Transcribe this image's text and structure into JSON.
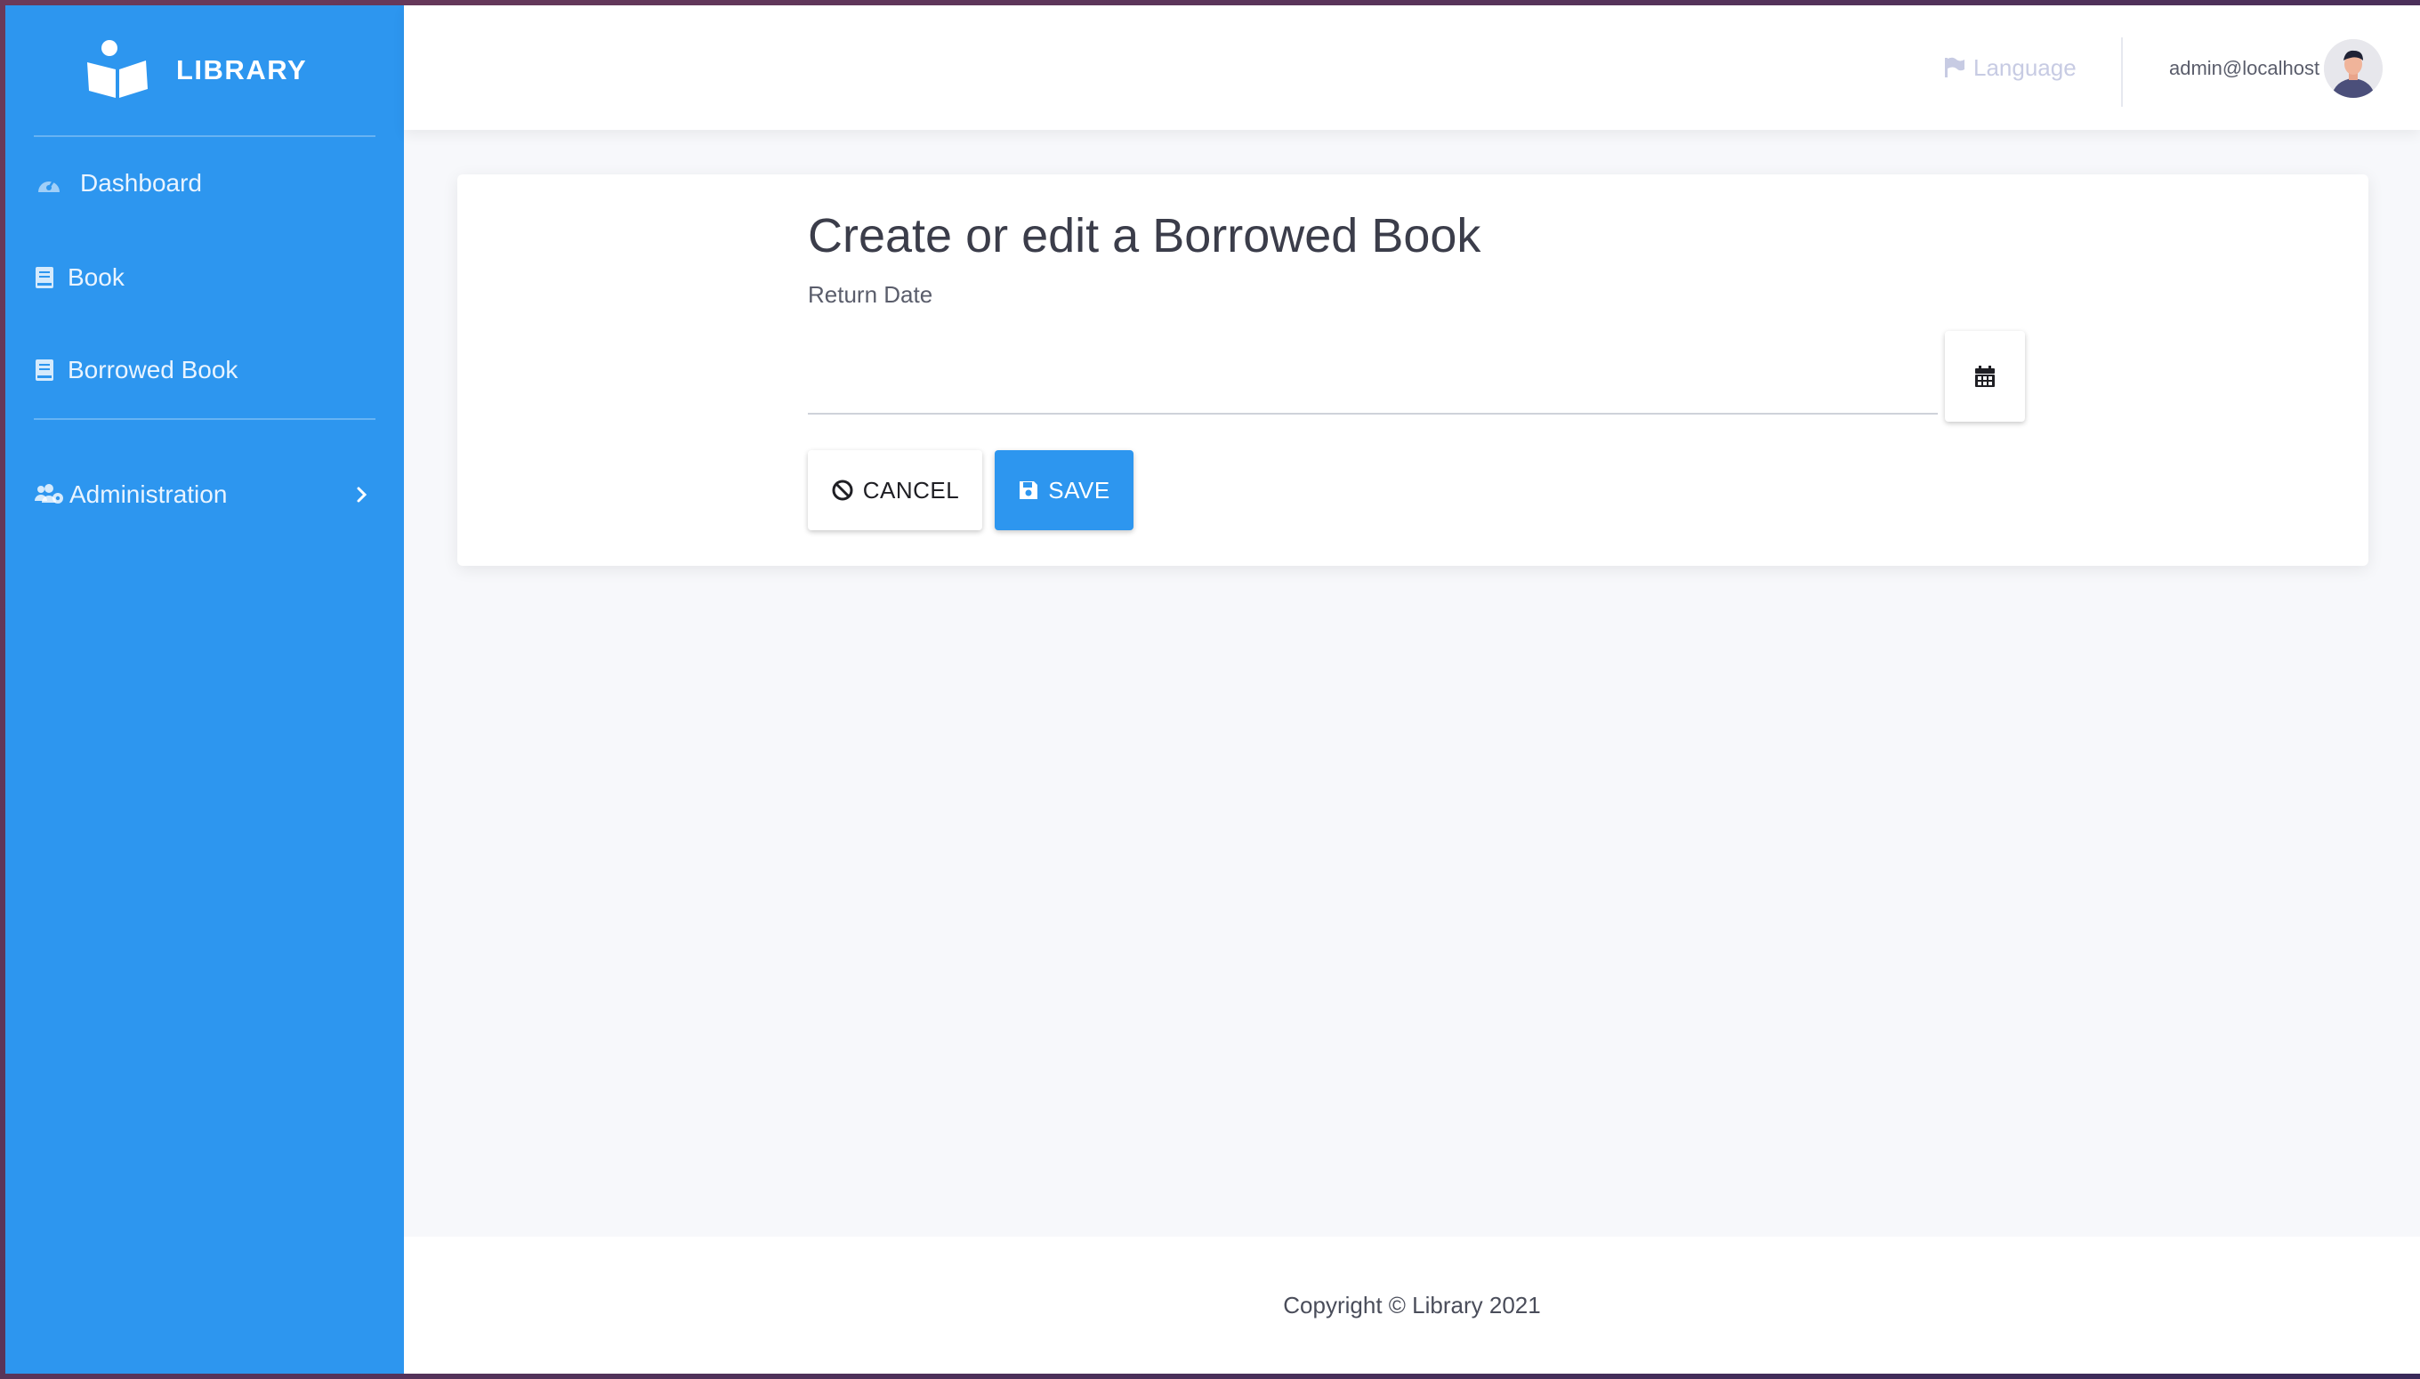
{
  "brand": {
    "name": "LIBRARY",
    "logo_icon": "reader-book-icon"
  },
  "sidebar": {
    "items": [
      {
        "label": "Dashboard",
        "icon": "gauge-icon"
      },
      {
        "label": "Book",
        "icon": "book-icon"
      },
      {
        "label": "Borrowed Book",
        "icon": "book-icon"
      },
      {
        "label": "Administration",
        "icon": "users-cog-icon",
        "has_submenu": true
      }
    ]
  },
  "header": {
    "language_label": "Language",
    "user_email": "admin@localhost"
  },
  "form": {
    "title": "Create or edit a Borrowed Book",
    "return_date_label": "Return Date",
    "return_date_value": "",
    "cancel_label": "CANCEL",
    "save_label": "SAVE"
  },
  "footer": {
    "copyright": "Copyright © Library 2021"
  },
  "colors": {
    "primary": "#2d96ef",
    "background": "#f7f8fb",
    "text": "#3b3d4a"
  }
}
